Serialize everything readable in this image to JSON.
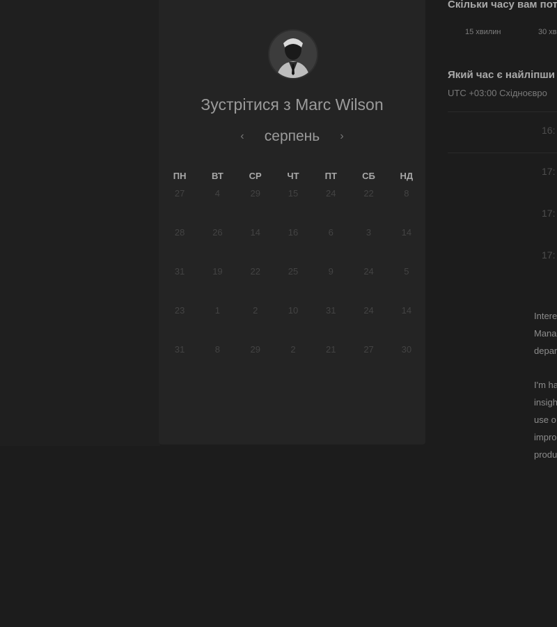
{
  "booking": {
    "title": "Зустрітися з Marc Wilson",
    "month": "серпень",
    "weekdays": [
      "ПН",
      "ВТ",
      "СР",
      "ЧТ",
      "ПТ",
      "СБ",
      "НД"
    ],
    "weeks": [
      [
        "27",
        "4",
        "29",
        "15",
        "24",
        "22",
        "8"
      ],
      [
        "28",
        "26",
        "14",
        "16",
        "6",
        "3",
        "14"
      ],
      [
        "31",
        "19",
        "22",
        "25",
        "9",
        "24",
        "5"
      ],
      [
        "23",
        "1",
        "2",
        "10",
        "31",
        "24",
        "14"
      ],
      [
        "31",
        "8",
        "29",
        "2",
        "21",
        "27",
        "30"
      ]
    ]
  },
  "duration": {
    "question": "Скільки часу вам пот",
    "options": [
      "15 хвилин",
      "30 хв"
    ]
  },
  "time": {
    "question": "Який час є найліпши",
    "timezone": "UTC +03:00 Східноєвро",
    "slots": [
      "16:",
      "17:",
      "17:",
      "17:"
    ]
  },
  "description": {
    "para1": "Intere\nMana\ndepar",
    "para2": "I'm ha\ninsigh\nuse o\nimpro\nprodu"
  },
  "icons": {
    "prev": "chevron-left-icon",
    "next": "chevron-right-icon"
  },
  "colors": {
    "background": "#1c1c1c",
    "card": "#242424",
    "text": "#9b9b9b",
    "muted_day": "#434343"
  }
}
